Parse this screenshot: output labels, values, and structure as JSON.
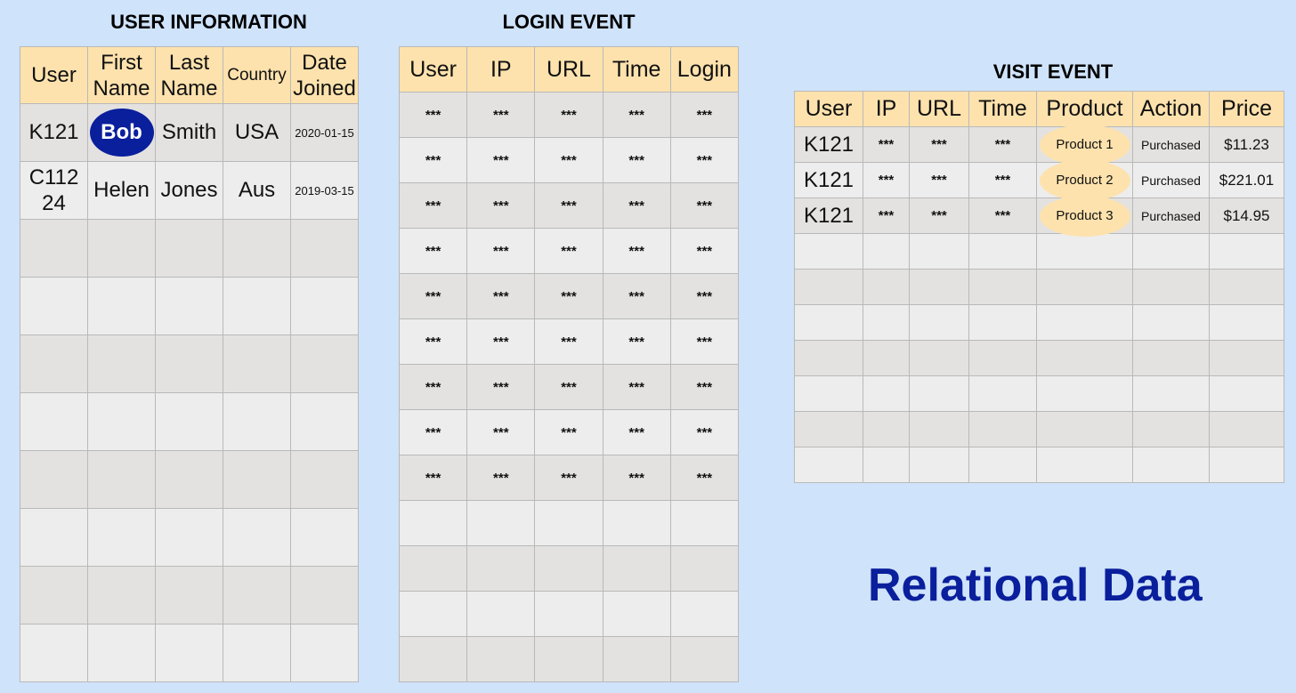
{
  "user_info": {
    "title": "USER INFORMATION",
    "headers": [
      [
        "User"
      ],
      [
        "First",
        "Name"
      ],
      [
        "Last",
        "Name"
      ],
      [
        "Country"
      ],
      [
        "Date",
        "Joined"
      ]
    ],
    "rows": [
      {
        "user": "K121",
        "first": "Bob",
        "last": "Smith",
        "country": "USA",
        "date": "2020-01-15"
      },
      {
        "user": "C112 24",
        "first": "Helen",
        "last": "Jones",
        "country": "Aus",
        "date": "2019-03-15"
      }
    ],
    "empty_rows": 8
  },
  "login_event": {
    "title": "LOGIN EVENT",
    "headers": [
      "User",
      "IP",
      "URL",
      "Time",
      "Login"
    ],
    "masked_value": "***",
    "masked_rows": 9,
    "empty_rows": 4
  },
  "visit_event": {
    "title": "VISIT EVENT",
    "headers": [
      "User",
      "IP",
      "URL",
      "Time",
      "Product",
      "Action",
      "Price"
    ],
    "masked_value": "***",
    "rows": [
      {
        "user": "K121",
        "product": "Product 1",
        "action": "Purchased",
        "price": "$11.23"
      },
      {
        "user": "K121",
        "product": "Product 2",
        "action": "Purchased",
        "price": "$221.01"
      },
      {
        "user": "K121",
        "product": "Product 3",
        "action": "Purchased",
        "price": "$14.95"
      }
    ],
    "empty_rows": 7
  },
  "caption": "Relational Data",
  "colors": {
    "background": "#cfe3fa",
    "header_fill": "#fde2ad",
    "highlight": "#0a1f9c"
  }
}
